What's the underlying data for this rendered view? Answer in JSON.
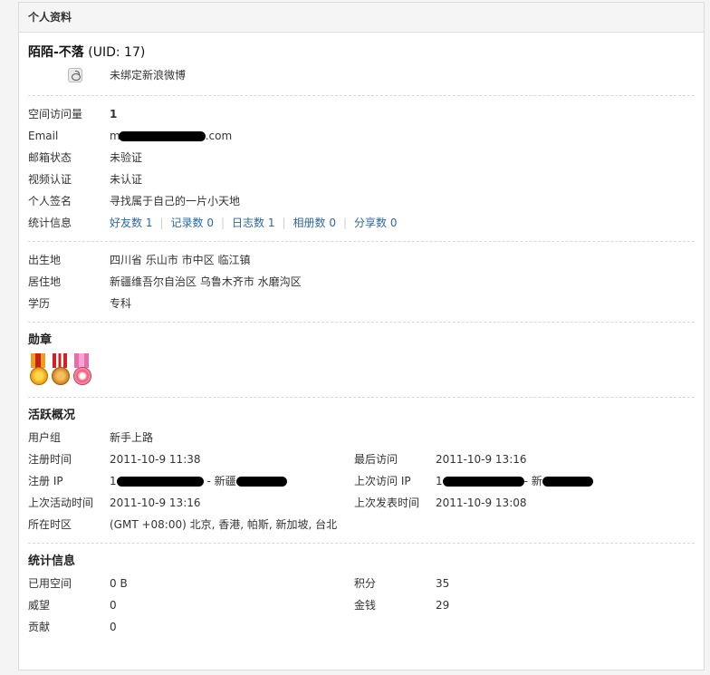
{
  "header": {
    "title": "个人资料"
  },
  "profile": {
    "name": "陌陌-不落",
    "uid_text": "(UID: 17)",
    "weibo_text": "未绑定新浪微博"
  },
  "info": {
    "visits_label": "空间访问量",
    "visits_value": "1",
    "email_label": "Email",
    "email_value": "m",
    "email_suffix": ".com",
    "mail_status_label": "邮箱状态",
    "mail_status_value": "未验证",
    "video_label": "视频认证",
    "video_value": "未认证",
    "sign_label": "个人签名",
    "sign_value": "寻找属于自己的一片小天地",
    "stats_label": "统计信息",
    "stats": [
      "好友数 1",
      "记录数 0",
      "日志数 1",
      "相册数 0",
      "分享数 0"
    ]
  },
  "location": {
    "birth_label": "出生地",
    "birth_value": "四川省 乐山市 市中区 临江镇",
    "live_label": "居住地",
    "live_value": "新疆维吾尔自治区 乌鲁木齐市 水磨沟区",
    "edu_label": "学历",
    "edu_value": "专科"
  },
  "medals": {
    "title": "勋章"
  },
  "activity": {
    "title": "活跃概况",
    "group_label": "用户组",
    "group_value": "新手上路",
    "reg_time_label": "注册时间",
    "reg_time_value": "2011-10-9 11:38",
    "last_visit_label": "最后访问",
    "last_visit_value": "2011-10-9 13:16",
    "reg_ip_label": "注册 IP",
    "reg_ip_prefix": "1",
    "reg_ip_suffix": " - 新疆",
    "last_ip_label": "上次访问 IP",
    "last_ip_prefix": "1",
    "last_ip_suffix": "- 新",
    "last_active_label": "上次活动时间",
    "last_active_value": "2011-10-9 13:16",
    "last_post_label": "上次发表时间",
    "last_post_value": "2011-10-9 13:08",
    "tz_label": "所在时区",
    "tz_value": "(GMT +08:00) 北京, 香港, 帕斯, 新加坡, 台北"
  },
  "stat_info": {
    "title": "统计信息",
    "space_label": "已用空间",
    "space_value": "0 B",
    "points_label": "积分",
    "points_value": "35",
    "prestige_label": "威望",
    "prestige_value": "0",
    "money_label": "金钱",
    "money_value": "29",
    "contrib_label": "贡献",
    "contrib_value": "0"
  },
  "colors": {
    "link": "#336699",
    "accent": "#f26c00"
  }
}
